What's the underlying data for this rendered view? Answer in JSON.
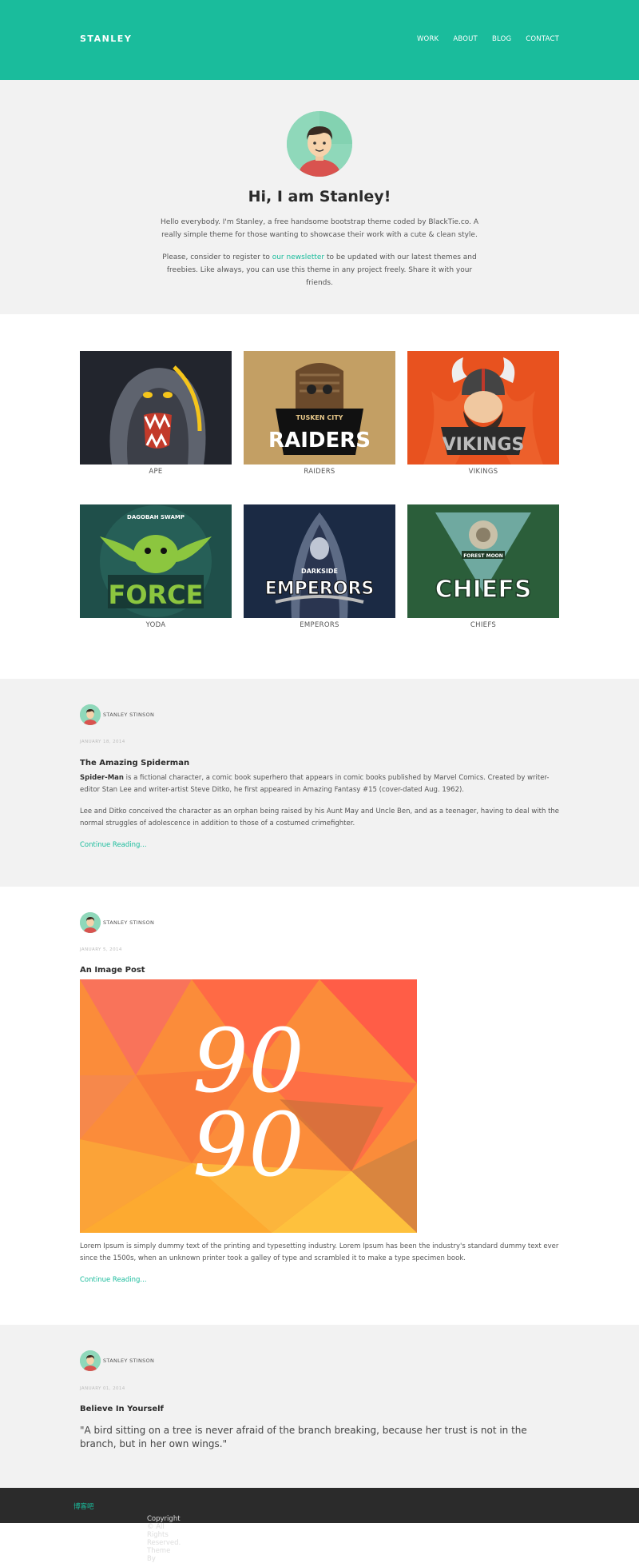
{
  "header": {
    "brand": "STANLEY",
    "nav": [
      "WORK",
      "ABOUT",
      "BLOG",
      "CONTACT"
    ]
  },
  "hero": {
    "title": "Hi, I am Stanley!",
    "intro": "Hello everybody. I'm Stanley, a free handsome bootstrap theme coded by BlackTie.co. A really simple theme for those wanting to showcase their work with a cute & clean style.",
    "para2_before": "Please, consider to register to ",
    "para2_link": "our newsletter",
    "para2_after": " to be updated with our latest themes and freebies. Like always, you can use this theme in any project freely. Share it with your friends."
  },
  "portfolio": {
    "items": [
      {
        "label": "APE",
        "caption": "",
        "bg": "#22252d"
      },
      {
        "label": "RAIDERS",
        "caption": "RAIDERS",
        "bg": "#c9a66b"
      },
      {
        "label": "VIKINGS",
        "caption": "VIKINGS",
        "bg": "#e8521f"
      },
      {
        "label": "YODA",
        "caption": "FORCE",
        "bg": "#1f4f4a"
      },
      {
        "label": "EMPERORS",
        "caption": "EMPERORS",
        "bg": "#1b2a44"
      },
      {
        "label": "CHIEFS",
        "caption": "CHIEFS",
        "bg": "#2b5e3a"
      }
    ],
    "tile_texts": {
      "raiders_top": "TUSKEN CITY",
      "yoda_top": "DAGOBAH SWAMP",
      "emperors_top": "DARKSIDE",
      "chiefs_top": "FOREST MOON"
    }
  },
  "posts": [
    {
      "author": "STANLEY STINSON",
      "date": "JANUARY 18, 2014",
      "title": "The Amazing Spiderman",
      "bold": "Spider-Man",
      "p1": " is a fictional character, a comic book superhero that appears in comic books published by Marvel Comics. Created by writer-editor Stan Lee and writer-artist Steve Ditko, he first appeared in Amazing Fantasy #15 (cover-dated Aug. 1962).",
      "p2": "Lee and Ditko conceived the character as an orphan being raised by his Aunt May and Uncle Ben, and as a teenager, having to deal with the normal struggles of adolescence in addition to those of a costumed crimefighter.",
      "more": "Continue Reading..."
    },
    {
      "author": "STANLEY STINSON",
      "date": "JANUARY 5, 2014",
      "title": "An Image Post",
      "image_text_1": "90",
      "image_text_2": "90",
      "p1": "Lorem Ipsum is simply dummy text of the printing and typesetting industry. Lorem Ipsum has been the industry's standard dummy text ever since the 1500s, when an unknown printer took a galley of type and scrambled it to make a type specimen book.",
      "more": "Continue Reading..."
    },
    {
      "author": "STANLEY STINSON",
      "date": "JANUARY 01, 2014",
      "title": "Believe In Yourself",
      "quote": "\"A bird sitting on a tree is never afraid of the branch breaking, because her trust is not in the branch, but in her own wings.\""
    }
  ],
  "footer": {
    "text": "Copyright © All Rights Reserved. Theme By ",
    "link": "博客吧"
  },
  "colors": {
    "accent": "#1abc9c",
    "light_bg": "#f2f2f2",
    "footer_bg": "#2b2b2b"
  }
}
